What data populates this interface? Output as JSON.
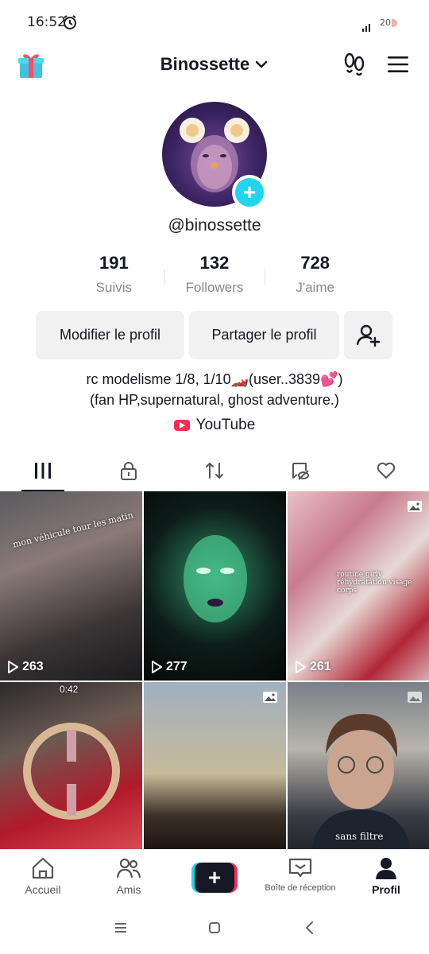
{
  "status_bar": {
    "time": "16:52",
    "battery": "20"
  },
  "header": {
    "username": "Binossette"
  },
  "profile": {
    "handle": "@binossette",
    "stats": [
      {
        "value": "191",
        "label": "Suivis"
      },
      {
        "value": "132",
        "label": "Followers"
      },
      {
        "value": "728",
        "label": "J'aime"
      }
    ],
    "edit_label": "Modifier le profil",
    "share_label": "Partager le profil",
    "bio_line1": "rc modelisme 1/8, 1/10🏎️(user..3839💕)",
    "bio_line2": "(fan HP,supernatural, ghost adventure.)",
    "link_label": "YouTube"
  },
  "tabs": [
    "videos-tab",
    "private-tab",
    "reposts-tab",
    "hidden-tab",
    "liked-tab"
  ],
  "videos": [
    {
      "views": "263",
      "kind": "video",
      "overlay": "mon véhicule tour les matin"
    },
    {
      "views": "277",
      "kind": "video"
    },
    {
      "views": "261",
      "kind": "photo",
      "overlay": "routine girly réhydratation visage corps"
    },
    {
      "views": "",
      "kind": "video",
      "duration": "0:42"
    },
    {
      "views": "",
      "kind": "photo"
    },
    {
      "views": "",
      "kind": "photo",
      "overlay": "sans filtre"
    }
  ],
  "bottom_nav": {
    "home": "Accueil",
    "friends": "Amis",
    "inbox": "Boîte de réception",
    "profile": "Profil"
  },
  "colors": {
    "accent_cyan": "#20d5ec",
    "accent_red": "#fe2c55",
    "text_dark": "#161823"
  }
}
